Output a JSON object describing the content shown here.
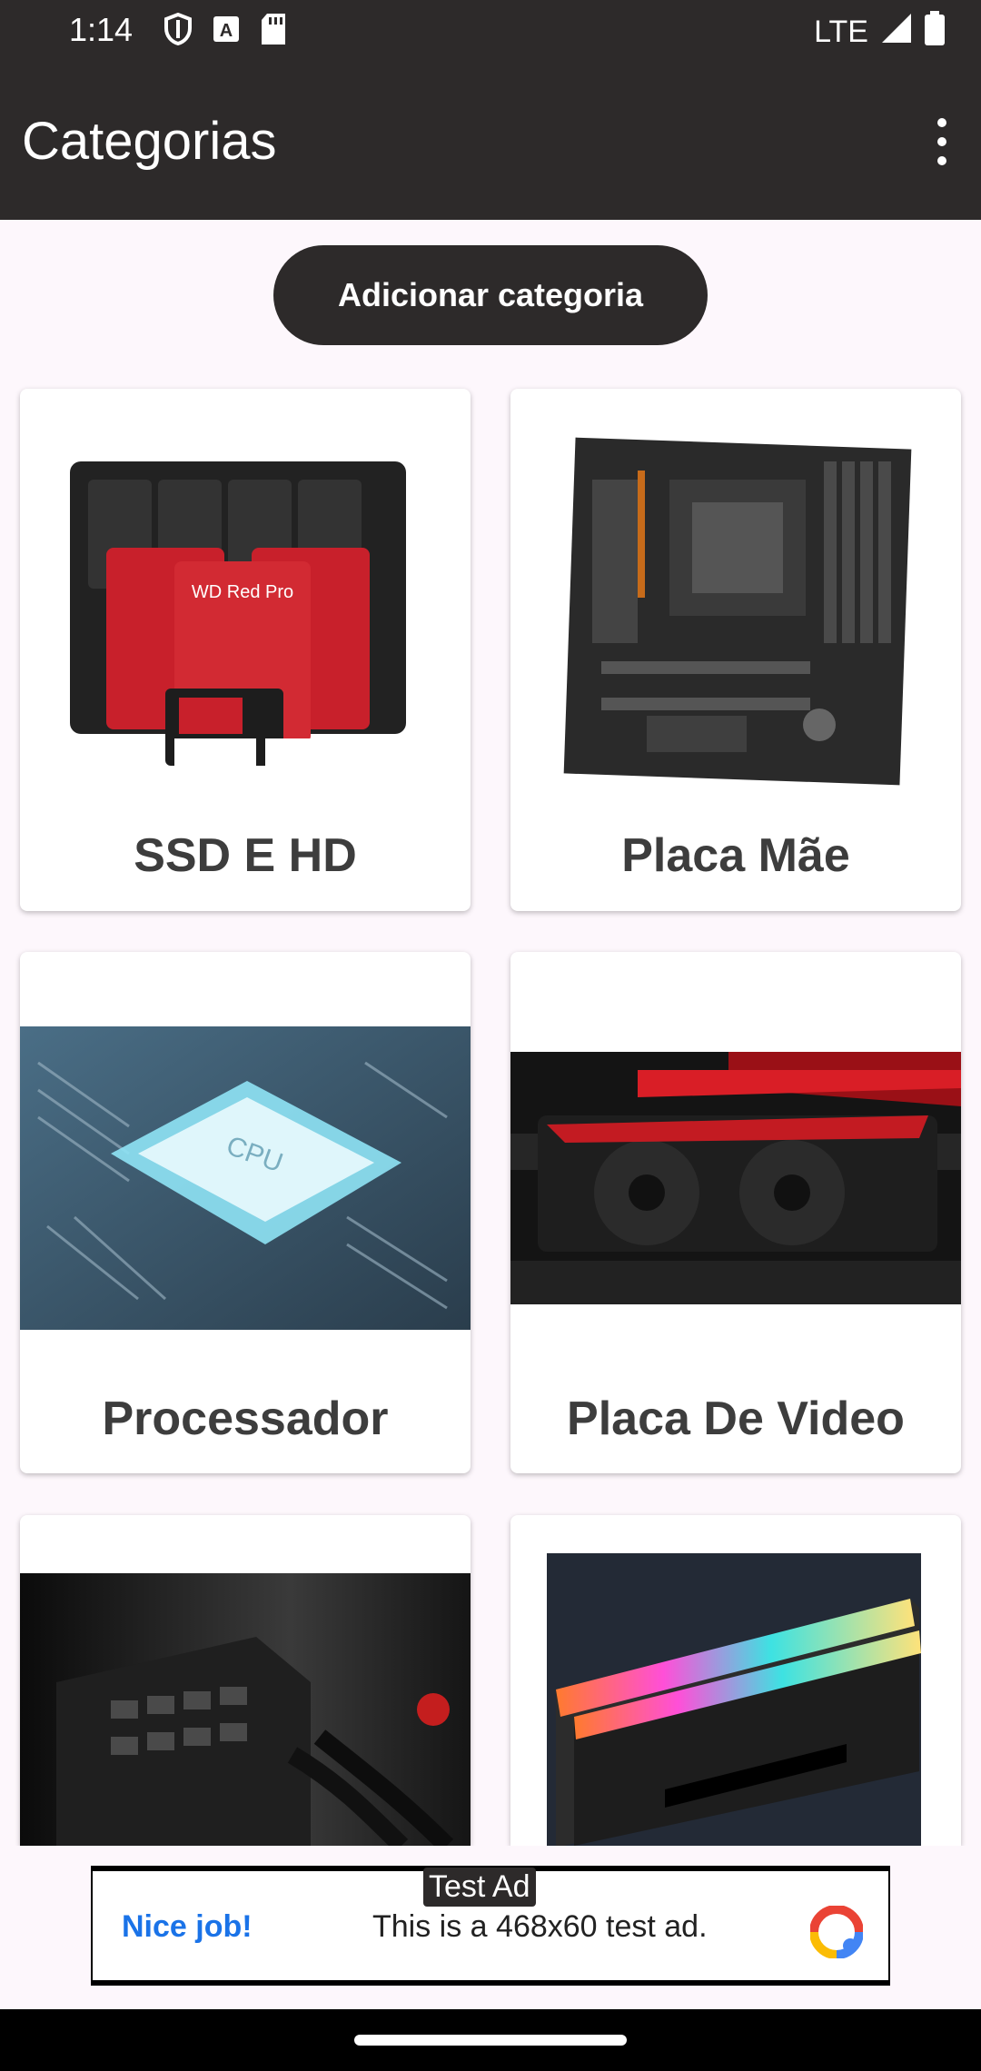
{
  "status_bar": {
    "time": "1:14",
    "left_icons": [
      "shield-icon",
      "a-box-icon",
      "sd-card-icon"
    ],
    "network": "LTE",
    "right_icons": [
      "signal-icon",
      "battery-icon"
    ]
  },
  "app_bar": {
    "title": "Categorias",
    "menu_icon": "more-vert-icon"
  },
  "actions": {
    "add_category_label": "Adicionar categoria"
  },
  "categories": [
    {
      "label": "SSD E HD",
      "image": "hard-drives-image"
    },
    {
      "label": "Placa Mãe",
      "image": "motherboard-image"
    },
    {
      "label": "Processador",
      "image": "cpu-image"
    },
    {
      "label": "Placa De Video",
      "image": "graphics-card-image"
    },
    {
      "label": "",
      "image": "power-supply-image"
    },
    {
      "label": "",
      "image": "rgb-ram-image"
    }
  ],
  "ad": {
    "tag": "Test Ad",
    "headline": "Nice job!",
    "body": "This is a 468x60 test ad."
  },
  "colors": {
    "bar_background": "#2d2a2a",
    "page_background": "#fdf7fc",
    "card_text": "#3d3d3d",
    "ad_link": "#1a73e8"
  }
}
